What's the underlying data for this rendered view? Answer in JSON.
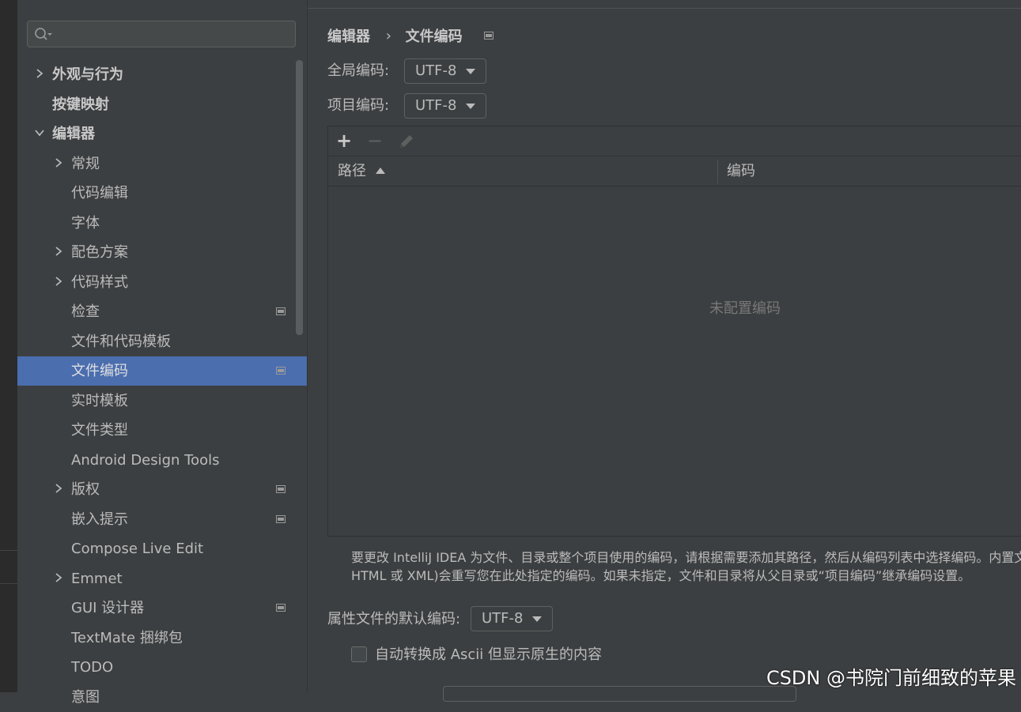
{
  "sidebar": {
    "search": {
      "placeholder": "",
      "icon": "search-icon"
    },
    "items": [
      {
        "label": "外观与行为",
        "level": 0,
        "expandable": true,
        "expanded": false,
        "bold": true,
        "pinned": false,
        "selected": false
      },
      {
        "label": "按键映射",
        "level": 0,
        "expandable": false,
        "expanded": false,
        "bold": true,
        "pinned": false,
        "selected": false
      },
      {
        "label": "编辑器",
        "level": 0,
        "expandable": true,
        "expanded": true,
        "bold": true,
        "pinned": false,
        "selected": false
      },
      {
        "label": "常规",
        "level": 1,
        "expandable": true,
        "expanded": false,
        "bold": false,
        "pinned": false,
        "selected": false
      },
      {
        "label": "代码编辑",
        "level": 1,
        "expandable": false,
        "expanded": false,
        "bold": false,
        "pinned": false,
        "selected": false
      },
      {
        "label": "字体",
        "level": 1,
        "expandable": false,
        "expanded": false,
        "bold": false,
        "pinned": false,
        "selected": false
      },
      {
        "label": "配色方案",
        "level": 1,
        "expandable": true,
        "expanded": false,
        "bold": false,
        "pinned": false,
        "selected": false
      },
      {
        "label": "代码样式",
        "level": 1,
        "expandable": true,
        "expanded": false,
        "bold": false,
        "pinned": false,
        "selected": false
      },
      {
        "label": "检查",
        "level": 1,
        "expandable": false,
        "expanded": false,
        "bold": false,
        "pinned": true,
        "selected": false
      },
      {
        "label": "文件和代码模板",
        "level": 1,
        "expandable": false,
        "expanded": false,
        "bold": false,
        "pinned": false,
        "selected": false
      },
      {
        "label": "文件编码",
        "level": 1,
        "expandable": false,
        "expanded": false,
        "bold": false,
        "pinned": true,
        "selected": true
      },
      {
        "label": "实时模板",
        "level": 1,
        "expandable": false,
        "expanded": false,
        "bold": false,
        "pinned": false,
        "selected": false
      },
      {
        "label": "文件类型",
        "level": 1,
        "expandable": false,
        "expanded": false,
        "bold": false,
        "pinned": false,
        "selected": false
      },
      {
        "label": "Android Design Tools",
        "level": 1,
        "expandable": false,
        "expanded": false,
        "bold": false,
        "pinned": false,
        "selected": false
      },
      {
        "label": "版权",
        "level": 1,
        "expandable": true,
        "expanded": false,
        "bold": false,
        "pinned": true,
        "selected": false
      },
      {
        "label": "嵌入提示",
        "level": 1,
        "expandable": false,
        "expanded": false,
        "bold": false,
        "pinned": true,
        "selected": false
      },
      {
        "label": "Compose Live Edit",
        "level": 1,
        "expandable": false,
        "expanded": false,
        "bold": false,
        "pinned": false,
        "selected": false
      },
      {
        "label": "Emmet",
        "level": 1,
        "expandable": true,
        "expanded": false,
        "bold": false,
        "pinned": false,
        "selected": false
      },
      {
        "label": "GUI 设计器",
        "level": 1,
        "expandable": false,
        "expanded": false,
        "bold": false,
        "pinned": true,
        "selected": false
      },
      {
        "label": "TextMate 捆绑包",
        "level": 1,
        "expandable": false,
        "expanded": false,
        "bold": false,
        "pinned": false,
        "selected": false
      },
      {
        "label": "TODO",
        "level": 1,
        "expandable": false,
        "expanded": false,
        "bold": false,
        "pinned": false,
        "selected": false
      },
      {
        "label": "意图",
        "level": 1,
        "expandable": false,
        "expanded": false,
        "bold": false,
        "pinned": false,
        "selected": false
      }
    ]
  },
  "breadcrumb": {
    "parent": "编辑器",
    "separator": "›",
    "current": "文件编码"
  },
  "global_encoding": {
    "label": "全局编码:",
    "value": "UTF-8"
  },
  "project_encoding": {
    "label": "项目编码:",
    "value": "UTF-8"
  },
  "table": {
    "toolbar": {
      "add": "+",
      "remove": "−",
      "edit_icon": "pencil-icon"
    },
    "columns": [
      {
        "label": "路径",
        "sort": "ascending"
      },
      {
        "label": "编码"
      }
    ],
    "empty_text": "未配置编码"
  },
  "help_text": {
    "line1": "要更改 IntelliJ IDEA 为文件、目录或整个项目使用的编码，请根据需要添加其路径，然后从编码列表中选择编码。内置文",
    "line2": "HTML 或 XML)会重写您在此处指定的编码。如果未指定，文件和目录将从父目录或“项目编码”继承编码设置。"
  },
  "properties_encoding": {
    "label": "属性文件的默认编码:",
    "value": "UTF-8"
  },
  "ascii_checkbox": {
    "label": "自动转换成 Ascii 但显示原生的内容",
    "checked": false
  },
  "watermark": "CSDN @书院门前细致的苹果",
  "colors": {
    "selection": "#4b6eaf",
    "panel": "#3c3f41",
    "text": "#bbbbbb"
  }
}
